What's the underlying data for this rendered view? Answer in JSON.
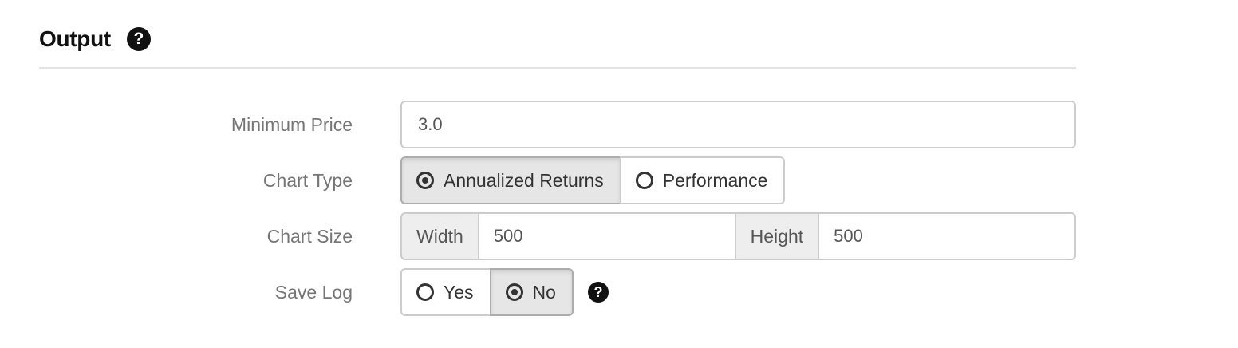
{
  "section": {
    "title": "Output",
    "help_icon": "?"
  },
  "minimum_price": {
    "label": "Minimum Price",
    "value": "3.0"
  },
  "chart_type": {
    "label": "Chart Type",
    "options": [
      "Annualized Returns",
      "Performance"
    ],
    "selected": "Annualized Returns"
  },
  "chart_size": {
    "label": "Chart Size",
    "width_label": "Width",
    "width_value": "500",
    "height_label": "Height",
    "height_value": "500"
  },
  "save_log": {
    "label": "Save Log",
    "options": [
      "Yes",
      "No"
    ],
    "selected": "No",
    "help_icon": "?"
  },
  "icons": {
    "help": "question-circle-icon",
    "radio_checked": "radio-checked-icon",
    "radio_unchecked": "radio-unchecked-icon"
  },
  "colors": {
    "active_button_bg": "#e6e6e6",
    "border": "#cccccc",
    "label_text": "#757575",
    "addon_bg": "#eeeeee"
  }
}
